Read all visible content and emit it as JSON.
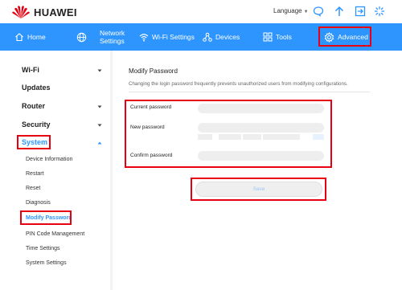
{
  "brand": {
    "name": "HUAWEI",
    "color": "#e60012"
  },
  "topbar": {
    "language_label": "Language",
    "icons": [
      "chat-icon",
      "upload-arrow-icon",
      "logout-icon",
      "loading-icon"
    ]
  },
  "nav": {
    "home": "Home",
    "network_line1": "Network",
    "network_line2": "Settings",
    "wifi": "Wi-Fi Settings",
    "devices": "Devices",
    "tools": "Tools",
    "advanced": "Advanced",
    "active": "Advanced",
    "accent_color": "#2e95ff"
  },
  "sidebar": {
    "sections": [
      {
        "label": "Wi-Fi",
        "expanded": false
      },
      {
        "label": "Updates"
      },
      {
        "label": "Router",
        "expanded": false
      },
      {
        "label": "Security",
        "expanded": false
      },
      {
        "label": "System",
        "expanded": true
      }
    ],
    "system_items": [
      "Device Information",
      "Restart",
      "Reset",
      "Diagnosis",
      "Modify Password",
      "PIN Code Management",
      "Time Settings",
      "System Settings"
    ],
    "active_item": "Modify Password"
  },
  "main": {
    "title": "Modify Password",
    "description": "Changing the login password frequently prevents unauthorized users from modifying configurations.",
    "fields": {
      "current": {
        "label": "Current password",
        "value": ""
      },
      "new": {
        "label": "New password",
        "value": ""
      },
      "confirm": {
        "label": "Confirm password",
        "value": ""
      }
    },
    "save_label": "Save"
  }
}
